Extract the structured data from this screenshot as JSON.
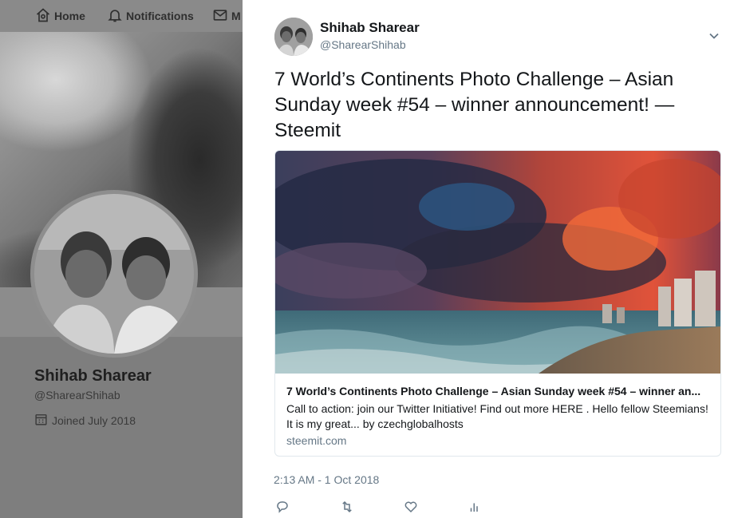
{
  "background": {
    "nav": {
      "home_label": "Home",
      "notifications_label": "Notifications",
      "messages_label": "M"
    },
    "profile": {
      "name": "Shihab Sharear",
      "handle": "@SharearShihab",
      "joined": "Joined July 2018"
    }
  },
  "tweet": {
    "author_name": "Shihab Sharear",
    "author_handle": "@SharearShihab",
    "text": "7 World’s Continents Photo Challenge – Asian Sunday week #54 – winner announcement! — Steemit",
    "card": {
      "title": "7 World’s Continents Photo Challenge – Asian Sunday week #54 – winner an...",
      "description": "Call to action: join our Twitter Initiative! Find out more HERE . Hello fellow Steemians! It is my great... by czechglobalhosts",
      "domain": "steemit.com"
    },
    "timestamp": "2:13 AM - 1 Oct 2018"
  },
  "icons": {
    "home": "home-icon",
    "notifications": "bell-icon",
    "messages": "envelope-icon",
    "calendar": "calendar-icon",
    "caret": "chevron-down-icon",
    "reply": "reply-icon",
    "retweet": "retweet-icon",
    "like": "heart-icon",
    "analytics": "analytics-icon"
  },
  "colors": {
    "text_primary": "#14171a",
    "text_secondary": "#657786",
    "card_border": "#e1e8ed",
    "overlay_gray": "#7e7e7e"
  }
}
